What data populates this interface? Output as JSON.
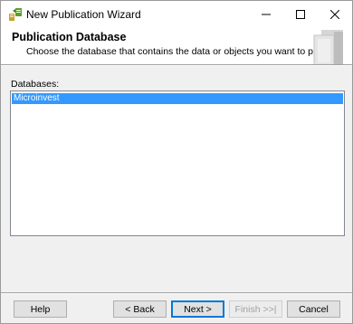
{
  "window": {
    "title": "New Publication Wizard"
  },
  "header": {
    "title": "Publication Database",
    "subtitle": "Choose the database that contains the data or objects you want to publish."
  },
  "databases": {
    "label": "Databases:",
    "items": [
      {
        "name": "Microinvest",
        "selected": true
      }
    ]
  },
  "buttons": {
    "help": "Help",
    "back": "< Back",
    "next": "Next >",
    "finish": "Finish >>|",
    "cancel": "Cancel"
  },
  "colors": {
    "selection": "#3399ff",
    "default_button_border": "#0078d7"
  }
}
